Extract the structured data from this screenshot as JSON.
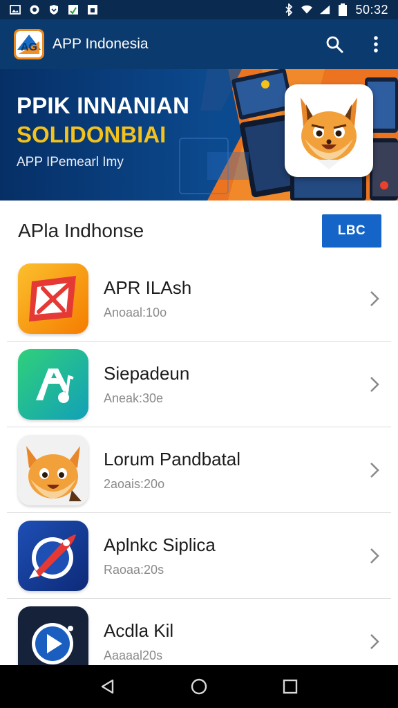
{
  "status_bar": {
    "time": "50:32",
    "icons": [
      "image-icon",
      "sync-icon",
      "shield-icon",
      "download-icon",
      "notification-icon",
      "bluetooth-icon",
      "wifi-icon",
      "signal-icon",
      "battery-icon"
    ]
  },
  "app_bar": {
    "title": "APP Indonesia",
    "logo_text": "AG",
    "actions": [
      "search-icon",
      "more-vert-icon"
    ]
  },
  "banner": {
    "title_line1": "PPIK INNANIAN",
    "title_line2": "SOLIDONBIAI",
    "subtitle": "APP IPemearl Imy"
  },
  "section": {
    "title": "APla Indhonse",
    "button_label": "LBC"
  },
  "apps": [
    {
      "name": "APR ILAsh",
      "meta": "Anoaal:10o",
      "icon": "flag-envelope-icon"
    },
    {
      "name": "Siepadeun",
      "meta": "Aneak:30e",
      "icon": "music-a-icon"
    },
    {
      "name": "Lorum Pandbatal",
      "meta": "2aoais:20o",
      "icon": "fox-mascot-icon"
    },
    {
      "name": "Aplnkc Siplica",
      "meta": "Raoaa:20s",
      "icon": "rocket-globe-icon"
    },
    {
      "name": "Acdla Kil",
      "meta": "Aaaaal20s",
      "icon": "play-circle-icon"
    }
  ],
  "colors": {
    "appbar": "#0b3a6e",
    "status_bar": "#0a2a4f",
    "accent_button": "#1565c8",
    "banner_yellow": "#f4c21c",
    "banner_orange": "#f07b22"
  },
  "nav_bar": [
    "back-icon",
    "home-icon",
    "recents-icon"
  ]
}
